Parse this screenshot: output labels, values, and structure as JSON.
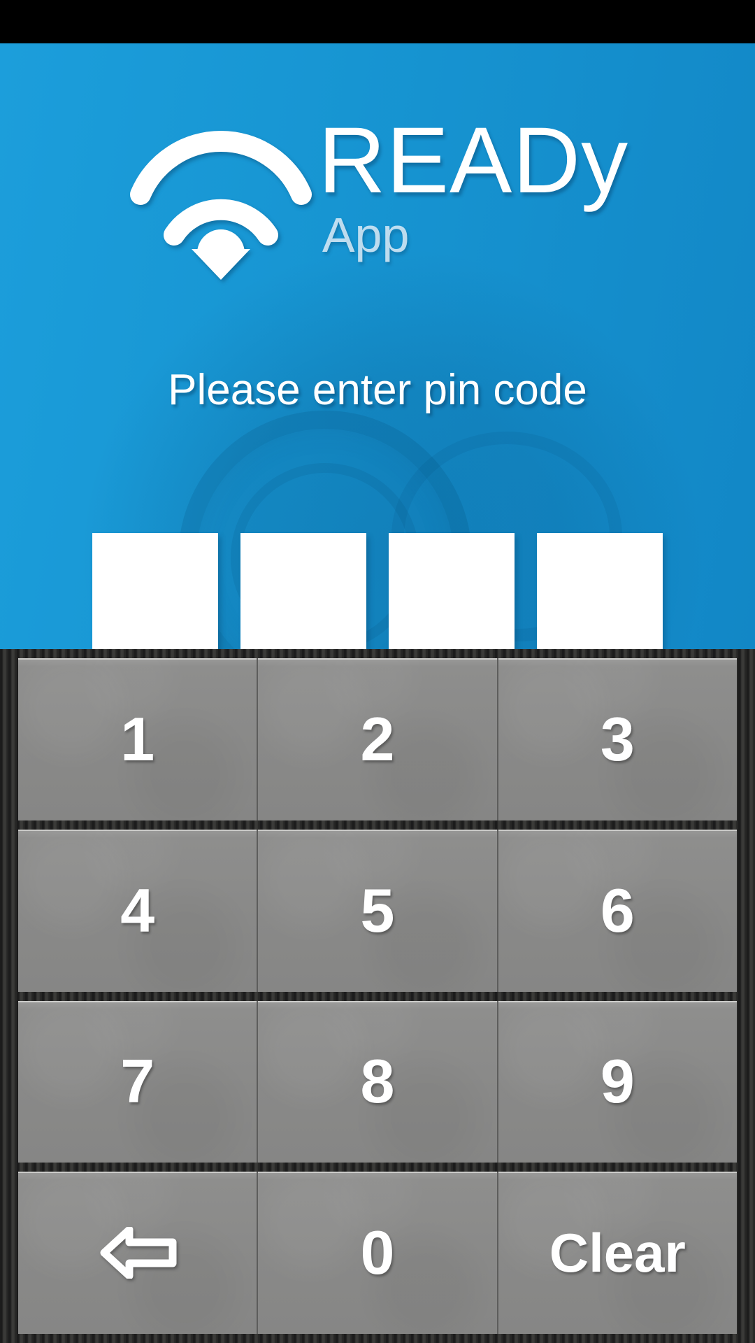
{
  "statusbar": {
    "background": "#000000"
  },
  "header": {
    "background_top": "#1c9edb",
    "background_bottom": "#1287c6",
    "logo_icon": "wifi-download-arrow-icon",
    "title": "READy",
    "subtitle": "App",
    "prompt": "Please enter pin code"
  },
  "pin": {
    "length": 4,
    "boxes": [
      "",
      "",
      "",
      ""
    ],
    "box_color": "#ffffff"
  },
  "keypad": {
    "key_color": "#8a8a89",
    "label_color": "#ffffff",
    "rows": [
      [
        {
          "label": "1",
          "name": "key-1",
          "type": "digit"
        },
        {
          "label": "2",
          "name": "key-2",
          "type": "digit"
        },
        {
          "label": "3",
          "name": "key-3",
          "type": "digit"
        }
      ],
      [
        {
          "label": "4",
          "name": "key-4",
          "type": "digit"
        },
        {
          "label": "5",
          "name": "key-5",
          "type": "digit"
        },
        {
          "label": "6",
          "name": "key-6",
          "type": "digit"
        }
      ],
      [
        {
          "label": "7",
          "name": "key-7",
          "type": "digit"
        },
        {
          "label": "8",
          "name": "key-8",
          "type": "digit"
        },
        {
          "label": "9",
          "name": "key-9",
          "type": "digit"
        }
      ],
      [
        {
          "label": "",
          "name": "key-backspace",
          "type": "icon",
          "icon": "arrow-left-icon"
        },
        {
          "label": "0",
          "name": "key-0",
          "type": "digit"
        },
        {
          "label": "Clear",
          "name": "key-clear",
          "type": "word"
        }
      ]
    ]
  }
}
